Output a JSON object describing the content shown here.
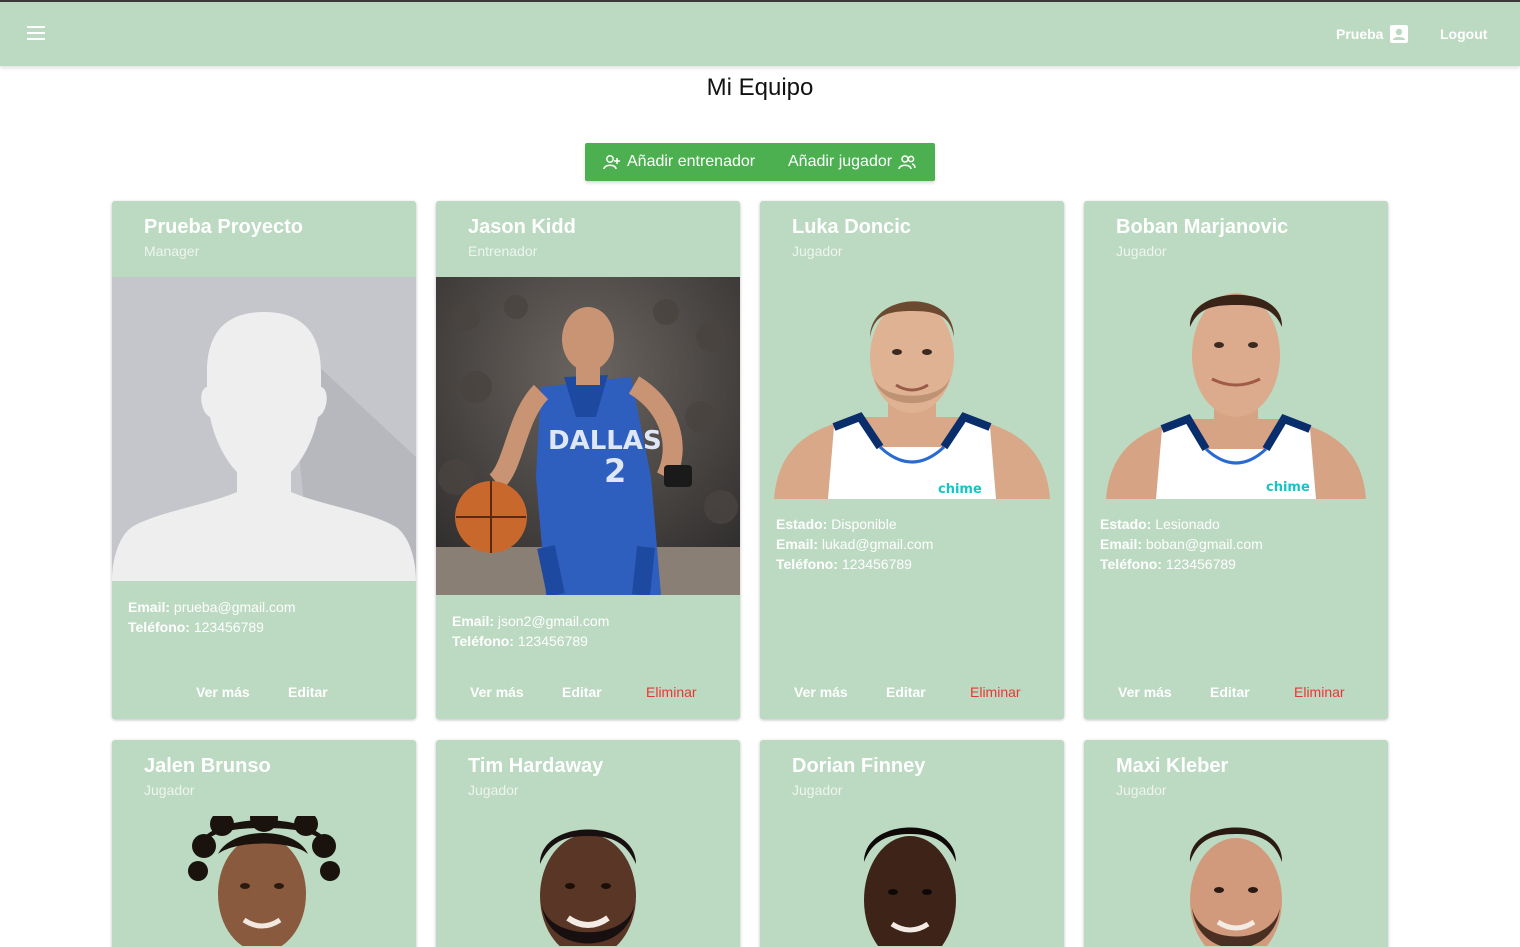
{
  "header": {
    "user_label": "Prueba",
    "logout_label": "Logout"
  },
  "page_title": "Mi Equipo",
  "actions": {
    "add_coach_label": "Añadir entrenador",
    "add_player_label": "Añadir jugador"
  },
  "labels": {
    "estado": "Estado:",
    "email": "Email:",
    "telefono": "Teléfono:",
    "ver_mas": "Ver más",
    "editar": "Editar",
    "eliminar": "Eliminar"
  },
  "members": [
    {
      "name": "Prueba Proyecto",
      "role": "Manager",
      "email": "prueba@gmail.com",
      "phone": "123456789"
    },
    {
      "name": "Jason Kidd",
      "role": "Entrenador",
      "email": "json2@gmail.com",
      "phone": "123456789"
    },
    {
      "name": "Luka Doncic",
      "role": "Jugador",
      "status": "Disponible",
      "email": "lukad@gmail.com",
      "phone": "123456789"
    },
    {
      "name": "Boban Marjanovic",
      "role": "Jugador",
      "status": "Lesionado",
      "email": "boban@gmail.com",
      "phone": "123456789"
    },
    {
      "name": "Jalen Brunso",
      "role": "Jugador"
    },
    {
      "name": "Tim Hardaway",
      "role": "Jugador"
    },
    {
      "name": "Dorian Finney",
      "role": "Jugador"
    },
    {
      "name": "Maxi Kleber",
      "role": "Jugador"
    }
  ],
  "colors": {
    "appbar": "#bcd9c1",
    "card": "#bcd9c1",
    "button_group": "#4caf50",
    "delete": "#e53935"
  }
}
